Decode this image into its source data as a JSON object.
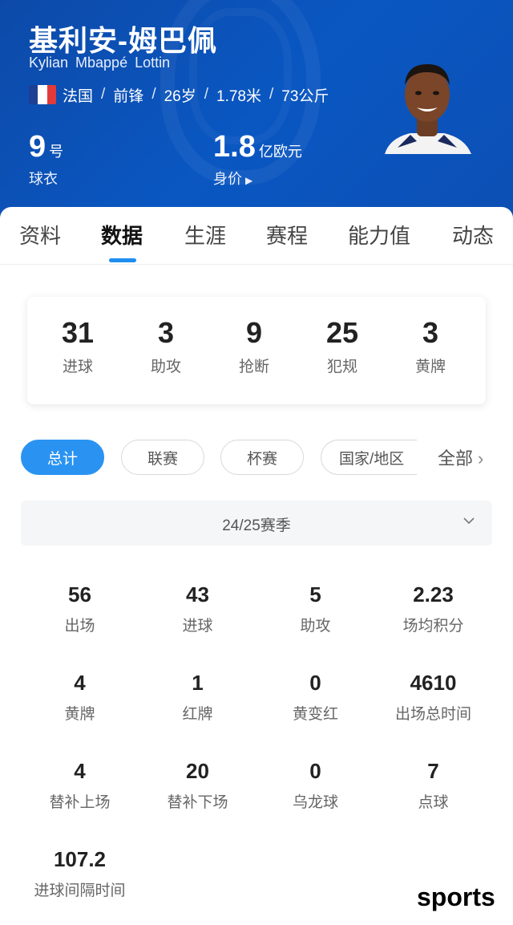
{
  "player": {
    "name_cn": "基利安-姆巴佩",
    "name_en": "Kylian  Mbappé  Lottin",
    "country": "法国",
    "position": "前锋",
    "age": "26岁",
    "height": "1.78米",
    "weight": "73公斤",
    "separator": "/",
    "shirt_number": "9",
    "shirt_unit": "号",
    "shirt_label": "球衣",
    "market_value": "1.8",
    "market_value_unit": "亿欧元",
    "market_value_label": "身价",
    "flag_colors": [
      "#1f3f95",
      "#ffffff",
      "#e23a3a"
    ]
  },
  "tabs": [
    {
      "label": "资料"
    },
    {
      "label": "数据"
    },
    {
      "label": "生涯"
    },
    {
      "label": "赛程"
    },
    {
      "label": "能力值"
    },
    {
      "label": "动态"
    }
  ],
  "active_tab": "数据",
  "summary": [
    {
      "value": "31",
      "label": "进球"
    },
    {
      "value": "3",
      "label": "助攻"
    },
    {
      "value": "9",
      "label": "抢断"
    },
    {
      "value": "25",
      "label": "犯规"
    },
    {
      "value": "3",
      "label": "黄牌"
    }
  ],
  "filters": [
    {
      "label": "总计"
    },
    {
      "label": "联赛"
    },
    {
      "label": "杯赛"
    },
    {
      "label": "国家/地区"
    }
  ],
  "active_filter": "总计",
  "all_button": "全部",
  "season": "24/25赛季",
  "stats": [
    {
      "value": "56",
      "label": "出场"
    },
    {
      "value": "43",
      "label": "进球"
    },
    {
      "value": "5",
      "label": "助攻"
    },
    {
      "value": "2.23",
      "label": "场均积分"
    },
    {
      "value": "4",
      "label": "黄牌"
    },
    {
      "value": "1",
      "label": "红牌"
    },
    {
      "value": "0",
      "label": "黄变红"
    },
    {
      "value": "4610",
      "label": "出场总时间"
    },
    {
      "value": "4",
      "label": "替补上场"
    },
    {
      "value": "20",
      "label": "替补下场"
    },
    {
      "value": "0",
      "label": "乌龙球"
    },
    {
      "value": "7",
      "label": "点球"
    },
    {
      "value": "107.2",
      "label": "进球间隔时间"
    }
  ],
  "watermark": "sports",
  "colors": {
    "header_blue": "#0a57c2",
    "accent": "#2a93f2"
  }
}
